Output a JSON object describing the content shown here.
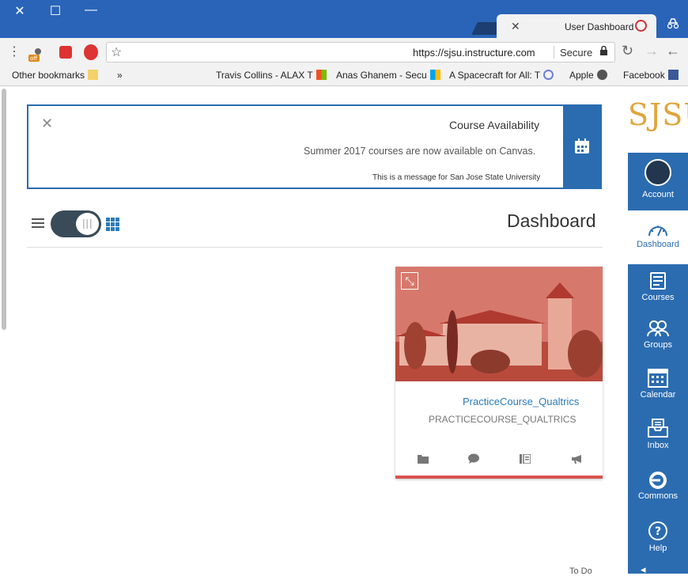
{
  "window": {
    "minimize": "—",
    "maximize": "☐",
    "close": "✕"
  },
  "tab": {
    "title": "User Dashboard",
    "close": "✕"
  },
  "omnibox": {
    "secure_label": "Secure",
    "url_scheme": "https://",
    "url_host": "sjsu.instructure.com"
  },
  "bookmarks": [
    {
      "label": "Facebook"
    },
    {
      "label": "Apple"
    },
    {
      "label": "A Spacecraft for All: T"
    },
    {
      "label": "Anas Ghanem - Secu"
    },
    {
      "label": "Travis Collins - ALAX T"
    }
  ],
  "bookmarks_more": "»",
  "other_bookmarks": "Other bookmarks",
  "announcement": {
    "title": "Course Availability",
    "body": "Summer 2017 courses are now available on Canvas.",
    "footer": "This is a message for San Jose State University",
    "close": "✕"
  },
  "dashboard": {
    "title": "Dashboard"
  },
  "course": {
    "name": "PracticeCourse_Qualtrics",
    "code": "PRACTICECOURSE_QUALTRICS"
  },
  "nav": {
    "logo": "SJSU",
    "items": [
      {
        "label": "Account"
      },
      {
        "label": "Dashboard"
      },
      {
        "label": "Courses"
      },
      {
        "label": "Groups"
      },
      {
        "label": "Calendar"
      },
      {
        "label": "Inbox"
      },
      {
        "label": "Commons"
      },
      {
        "label": "Help"
      }
    ]
  },
  "bottom_partial": "To Do",
  "colors": {
    "nav_blue": "#2b6cb0",
    "chrome_blue": "#2a64b8",
    "logo_gold": "#e0a53c",
    "card_accent": "#d9534f"
  }
}
